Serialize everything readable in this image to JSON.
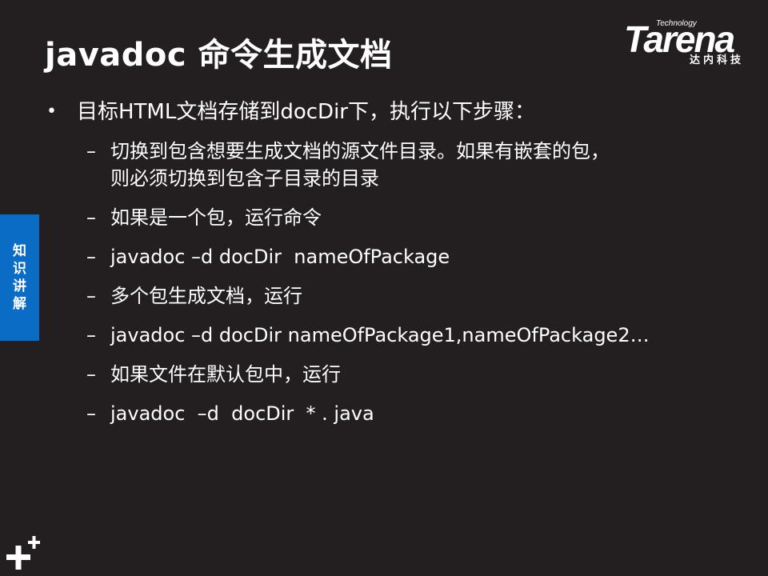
{
  "title": "javadoc 命令生成文档",
  "logo": {
    "technology": "Technology",
    "name": "Tarena",
    "chinese": "达内科技"
  },
  "side_tab": "知识讲解",
  "bullet": {
    "marker": "•",
    "text": "目标HTML文档存储到docDir下，执行以下步骤："
  },
  "sub_items": [
    {
      "dash": "–",
      "text": "切换到包含想要生成文档的源文件目录。如果有嵌套的包，\n则必须切换到包含子目录的目录"
    },
    {
      "dash": "–",
      "text": "如果是一个包，运行命令"
    },
    {
      "dash": "–",
      "text": "javadoc –d docDir  nameOfPackage"
    },
    {
      "dash": "–",
      "text": "多个包生成文档，运行"
    },
    {
      "dash": "–",
      "text": "javadoc –d docDir nameOfPackage1,nameOfPackage2…"
    },
    {
      "dash": "–",
      "text": "如果文件在默认包中，运行"
    },
    {
      "dash": "–",
      "text": "javadoc  –d  docDir  * . java"
    }
  ]
}
